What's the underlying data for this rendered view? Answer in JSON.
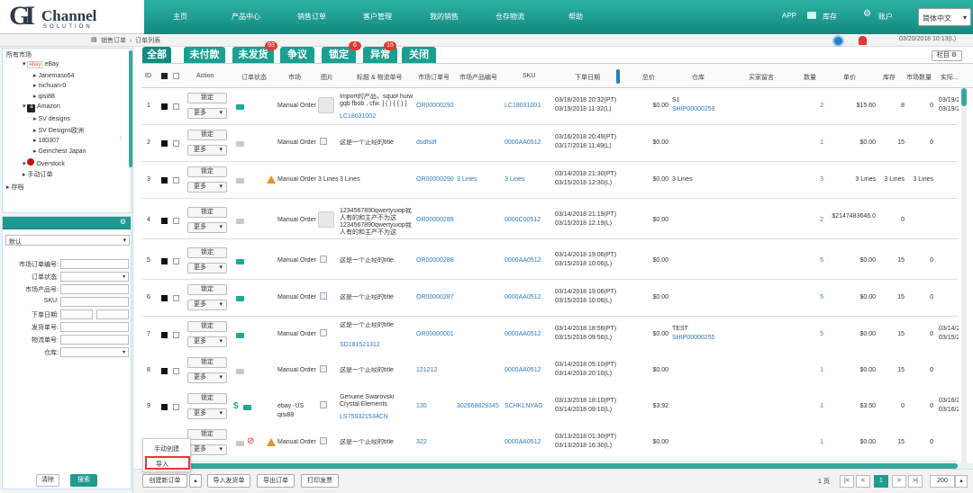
{
  "header": {
    "logo_text": "Channel",
    "logo_sub": "SOLUTION",
    "nav": [
      "主页",
      "产品中心",
      "销售订单",
      "客户管理",
      "我的销售",
      "仓存物流",
      "帮助"
    ],
    "app": "APP",
    "inventory": "库存",
    "account": "账户",
    "language": "简体中文"
  },
  "breadcrumb": [
    "销售订单",
    "订单列表"
  ],
  "datetime": "03/20/2018 10:13(L)",
  "sidebar": {
    "tree": [
      "所有市场",
      "eBay",
      "Janemaso54",
      "nichuan-0",
      "qisi88",
      "Amazon",
      "SV designs",
      "SV Designs欧洲",
      "180307",
      "Gemchest Japan",
      "Overstock",
      "手动订单",
      "存档"
    ],
    "ebay_badge": "ebay",
    "filter_default": "默认",
    "filter_labels": [
      "市场订单编号:",
      "订单状态:",
      "市场产品号:",
      "SKU:",
      "下单日期:",
      "发货单号:",
      "物流单号:",
      "仓库:"
    ],
    "clear_label": "清除",
    "search_label": "搜索"
  },
  "tabs": [
    {
      "label": "全部",
      "badge": ""
    },
    {
      "label": "未付款",
      "badge": ""
    },
    {
      "label": "未发货",
      "badge": "93"
    },
    {
      "label": "争议",
      "badge": ""
    },
    {
      "label": "锁定",
      "badge": "6"
    },
    {
      "label": "异常",
      "badge": "15"
    },
    {
      "label": "关闭",
      "badge": ""
    }
  ],
  "columns_label": "栏目",
  "table": {
    "headers": [
      "ID",
      "Action",
      "订单状态",
      "市场",
      "图片",
      "标题 & 物流单号",
      "市场订单号",
      "市场产品编号",
      "SKU",
      "下单日期",
      "总价",
      "仓库",
      "买家留言",
      "数量",
      "单价",
      "库存",
      "市场数量",
      "实际..."
    ],
    "lock_label": "锁定",
    "more_label": "更多",
    "rows": [
      {
        "id": "1",
        "market": "Manual Order",
        "title": "Import的产品，squof huiw gqb fbob , cfw. ] ( ) { { } }",
        "title2": "LC18031002",
        "order_no": "OR00000292",
        "product_no": "",
        "sku": "LC18031001",
        "date1": "03/18/2018 20:32(PT)",
        "date2": "03/19/2018 11:32(L)",
        "total": "$0.00",
        "warehouse": "S1",
        "warehouse2": "SHIP00000259",
        "qty": "2",
        "price": "$15.60",
        "stock": "8",
        "mkt_qty": "0",
        "actual": "03/19/2...",
        "actual2": "03/19/2..."
      },
      {
        "id": "2",
        "market": "Manual Order",
        "title": "这是一个正经的title",
        "title2": "",
        "order_no": "dsdfsdf",
        "product_no": "",
        "sku": "0000AA0512",
        "date1": "03/16/2018 20:49(PT)",
        "date2": "03/17/2018 11:49(L)",
        "total": "$0.00",
        "warehouse": "",
        "warehouse2": "",
        "qty": "1",
        "price": "$0.00",
        "stock": "15",
        "mkt_qty": "0",
        "actual": "",
        "actual2": ""
      },
      {
        "id": "3",
        "market": "Manual Order",
        "title": "3 Lines",
        "title2": "",
        "order_no": "OR00000290",
        "product_no": "3 Lines",
        "sku": "3 Lines",
        "date1": "03/14/2018 21:30(PT)",
        "date2": "03/15/2018 12:30(L)",
        "total": "$0.00",
        "warehouse": "3 Lines",
        "warehouse2": "",
        "qty": "3",
        "price": "3 Lines",
        "stock": "3 Lines",
        "mkt_qty": "3 Lines",
        "actual": "",
        "actual2": "",
        "img_text": "3 Lines"
      },
      {
        "id": "4",
        "market": "Manual Order",
        "title": "1234567890qwertyuiop我人有的和主产不为这",
        "title2": "1234567890qwertyuiop我人有的和主产不为这",
        "order_no": "OR00000289",
        "product_no": "",
        "sku": "0000C00512",
        "date1": "03/14/2018 21:19(PT)",
        "date2": "03/15/2018 12:19(L)",
        "total": "$0.00",
        "warehouse": "",
        "warehouse2": "",
        "qty": "2",
        "price": "$2147483646.0",
        "stock": "0",
        "mkt_qty": "",
        "actual": "",
        "actual2": ""
      },
      {
        "id": "5",
        "market": "Manual Order",
        "title": "这是一个正经的title",
        "title2": "",
        "order_no": "OR00000288",
        "product_no": "",
        "sku": "0000AA0512",
        "date1": "03/14/2018 19:06(PT)",
        "date2": "03/15/2018 10:06(L)",
        "total": "$0.00",
        "warehouse": "",
        "warehouse2": "",
        "qty": "5",
        "price": "$0.00",
        "stock": "15",
        "mkt_qty": "0",
        "actual": "",
        "actual2": ""
      },
      {
        "id": "6",
        "market": "Manual Order",
        "title": "这是一个正经的title",
        "title2": "",
        "order_no": "OR00000287",
        "product_no": "",
        "sku": "0000AA0512",
        "date1": "03/14/2018 19:06(PT)",
        "date2": "03/15/2018 10:06(L)",
        "total": "$0.00",
        "warehouse": "",
        "warehouse2": "",
        "qty": "5",
        "price": "$0.00",
        "stock": "15",
        "mkt_qty": "0",
        "actual": "",
        "actual2": ""
      },
      {
        "id": "7",
        "market": "Manual Order",
        "title": "这是一个正经的title",
        "title2": "SD181521312",
        "order_no": "OR00000001",
        "product_no": "",
        "sku": "0000AA0512",
        "date1": "03/14/2018 18:56(PT)",
        "date2": "03/15/2018 09:56(L)",
        "total": "$0.00",
        "warehouse": "TEST",
        "warehouse2": "SHIP00000255",
        "qty": "5",
        "price": "$0.00",
        "stock": "15",
        "mkt_qty": "0",
        "actual": "03/14/2...",
        "actual2": "03/15/2..."
      },
      {
        "id": "8",
        "market": "Manual Order",
        "title": "这是一个正经的title",
        "title2": "",
        "order_no": "121212",
        "product_no": "",
        "sku": "0000AA0512",
        "date1": "03/14/2018 05:10(PT)",
        "date2": "03/14/2018 20:10(L)",
        "total": "$0.00",
        "warehouse": "",
        "warehouse2": "",
        "qty": "1",
        "price": "$0.00",
        "stock": "15",
        "mkt_qty": "0",
        "actual": "",
        "actual2": ""
      },
      {
        "id": "9",
        "market": "ebay -US",
        "market2": "qisi88",
        "title": "Genuine Swarovski Crystal Elements",
        "title2": "LS759321534CN",
        "order_no": "130",
        "product_no": "302668829345",
        "sku": "SCHKLNYAG",
        "date1": "03/13/2018 18:10(PT)",
        "date2": "03/14/2018 09:10(L)",
        "total": "$3.92",
        "warehouse": "",
        "warehouse2": "",
        "qty": "1",
        "price": "$3.50",
        "stock": "0",
        "mkt_qty": "0",
        "actual": "03/16/2...",
        "actual2": "03/16/2..."
      },
      {
        "id": "10",
        "market": "Manual Order",
        "title": "这是一个正经的title",
        "title2": "",
        "order_no": "322",
        "product_no": "",
        "sku": "0000AA0512",
        "date1": "03/13/2018 01:30(PT)",
        "date2": "03/13/2018 16:30(L)",
        "total": "$0.00",
        "warehouse": "",
        "warehouse2": "",
        "qty": "1",
        "price": "$0.00",
        "stock": "15",
        "mkt_qty": "0",
        "actual": "",
        "actual2": ""
      }
    ]
  },
  "popup": {
    "manual": "手动创建",
    "import": "导入"
  },
  "bottom": {
    "create": "创建新订单",
    "import_ship": "导入发货单",
    "export": "导出订单",
    "print": "打印发票",
    "page_label": "1 页",
    "current_page": "1",
    "page_size": "200"
  }
}
